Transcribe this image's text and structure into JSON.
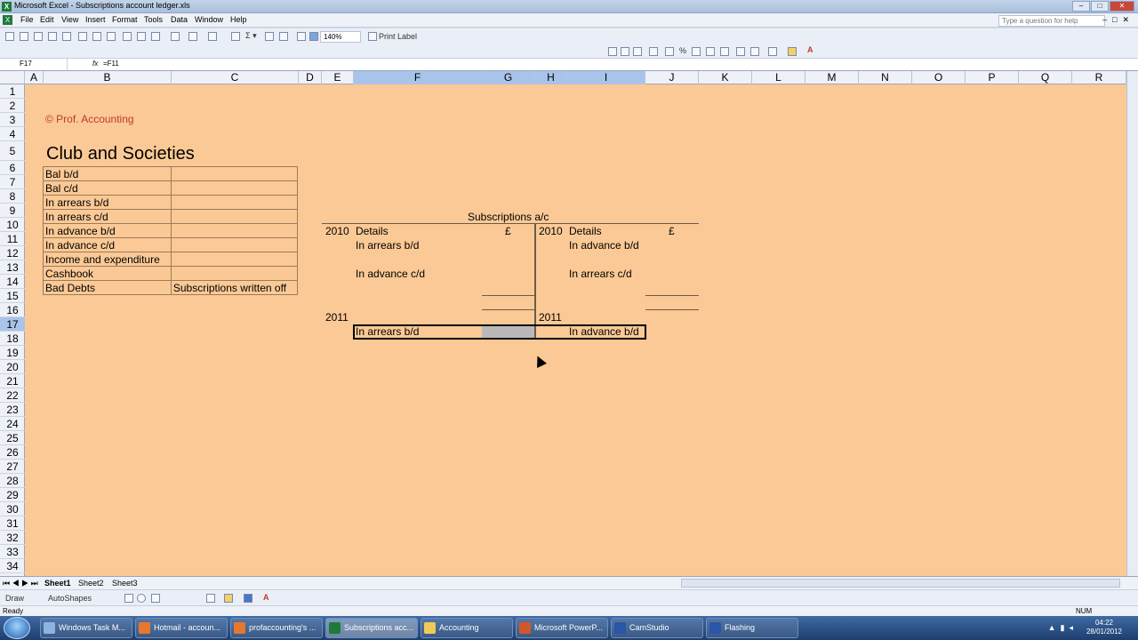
{
  "window": {
    "title": "Microsoft Excel - Subscriptions account ledger.xls"
  },
  "menu": {
    "items": [
      "File",
      "Edit",
      "View",
      "Insert",
      "Format",
      "Tools",
      "Data",
      "Window",
      "Help"
    ],
    "help_placeholder": "Type a question for help"
  },
  "toolbar": {
    "zoom": "140%",
    "print_label": "Print Label",
    "font": "Arial",
    "font_size": "10",
    "bold": "B",
    "italic": "I",
    "underline": "U",
    "currency": "%"
  },
  "formula_bar": {
    "name_box": "F17",
    "fx": "fx",
    "formula": "=F11"
  },
  "columns": [
    "A",
    "B",
    "C",
    "D",
    "E",
    "F",
    "G",
    "H",
    "I",
    "J",
    "K",
    "L",
    "M",
    "N",
    "O",
    "P",
    "Q",
    "R"
  ],
  "rows": [
    "1",
    "2",
    "3",
    "4",
    "5",
    "6",
    "7",
    "8",
    "9",
    "10",
    "11",
    "12",
    "13",
    "14",
    "15",
    "16",
    "17",
    "18",
    "19",
    "20",
    "21",
    "22",
    "23",
    "24",
    "25",
    "26",
    "27",
    "28",
    "29",
    "30",
    "31",
    "32",
    "33",
    "34"
  ],
  "selected": {
    "row": "17",
    "columns": [
      "F",
      "G",
      "H",
      "I"
    ]
  },
  "sheet": {
    "copyright": "© Prof. Accounting",
    "heading": "Club and Societies",
    "left_table": [
      [
        "Bal b/d",
        ""
      ],
      [
        "Bal c/d",
        ""
      ],
      [
        "In arrears b/d",
        ""
      ],
      [
        "In arrears c/d",
        ""
      ],
      [
        "In advance b/d",
        ""
      ],
      [
        "In advance c/d",
        ""
      ],
      [
        "Income and expenditure",
        ""
      ],
      [
        "Cashbook",
        ""
      ],
      [
        "Bad Debts",
        "Subscriptions written off"
      ]
    ],
    "account": {
      "title": "Subscriptions a/c",
      "debit": {
        "year": "2010",
        "details": "Details",
        "currency": "£",
        "line1": "In arrears b/d",
        "line2": "In advance c/d",
        "year2": "2011",
        "bd": "In arrears b/d"
      },
      "credit": {
        "year": "2010",
        "details": "Details",
        "currency": "£",
        "line1": "In advance b/d",
        "line2": "In arrears c/d",
        "year2": "2011",
        "bd": "In advance b/d"
      }
    }
  },
  "sheet_tabs": [
    "Sheet1",
    "Sheet2",
    "Sheet3"
  ],
  "drawbar": {
    "draw": "Draw",
    "autoshapes": "AutoShapes"
  },
  "status": {
    "left": "Ready",
    "right": "NUM"
  },
  "taskbar": {
    "items": [
      "Windows Task M...",
      "Hotmail - accoun...",
      "profaccounting's ...",
      "Subscriptions acc...",
      "Accounting",
      "Microsoft PowerP...",
      "CamStudio",
      "Flashing"
    ],
    "time": "04:22",
    "date": "28/01/2012"
  },
  "colors": {
    "sheet_bg": "#fbc995",
    "copyright": "#c0392b",
    "selection": "#a9c4ea"
  }
}
